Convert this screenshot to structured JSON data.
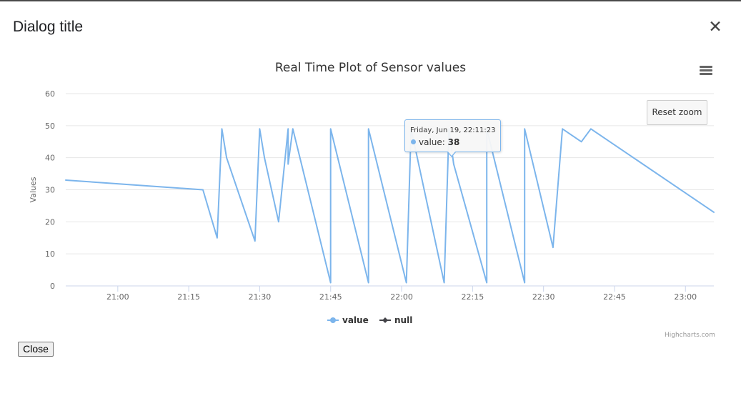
{
  "dialog": {
    "title": "Dialog title",
    "close_icon": "close-icon",
    "close_button_label": "Close"
  },
  "chart_toolbar": {
    "menu_icon": "hamburger-menu-icon",
    "reset_zoom_label": "Reset zoom"
  },
  "tooltip": {
    "header": "Friday, Jun 19, 22:11:23",
    "series_label": "value:",
    "value": "38"
  },
  "credits": "Highcharts.com",
  "colors": {
    "series_value": "#7cb5ec",
    "series_null": "#434348",
    "gridline": "#e6e6e6",
    "axis_text": "#666666"
  },
  "chart_data": {
    "type": "line",
    "title": "Real Time Plot of Sensor values",
    "xlabel": "",
    "ylabel": "Values",
    "ylim": [
      0,
      60
    ],
    "xlim": [
      "20:49",
      "23:06"
    ],
    "y_ticks": [
      "0",
      "10",
      "20",
      "30",
      "40",
      "50",
      "60"
    ],
    "x_ticks": [
      "21:00",
      "21:15",
      "21:30",
      "21:45",
      "22:00",
      "22:15",
      "22:30",
      "22:45",
      "23:00"
    ],
    "grid": true,
    "legend_position": "bottom-center",
    "series": [
      {
        "name": "value",
        "color": "#7cb5ec",
        "points": [
          [
            "20:49",
            33
          ],
          [
            "21:18",
            30
          ],
          [
            "21:21",
            15
          ],
          [
            "21:22",
            49
          ],
          [
            "21:23",
            40
          ],
          [
            "21:29",
            14
          ],
          [
            "21:30",
            49
          ],
          [
            "21:31",
            40
          ],
          [
            "21:34",
            20
          ],
          [
            "21:36",
            49
          ],
          [
            "21:36",
            38
          ],
          [
            "21:37",
            49
          ],
          [
            "21:45",
            1
          ],
          [
            "21:45",
            49
          ],
          [
            "21:53",
            1
          ],
          [
            "21:53",
            49
          ],
          [
            "22:01",
            1
          ],
          [
            "22:02",
            49
          ],
          [
            "22:09",
            1
          ],
          [
            "22:10",
            49
          ],
          [
            "22:11",
            38
          ],
          [
            "22:18",
            1
          ],
          [
            "22:18",
            49
          ],
          [
            "22:26",
            1
          ],
          [
            "22:26",
            49
          ],
          [
            "22:32",
            12
          ],
          [
            "22:34",
            49
          ],
          [
            "22:38",
            45
          ],
          [
            "22:40",
            49
          ],
          [
            "23:06",
            23
          ]
        ]
      },
      {
        "name": "null",
        "color": "#434348",
        "points": []
      }
    ]
  }
}
